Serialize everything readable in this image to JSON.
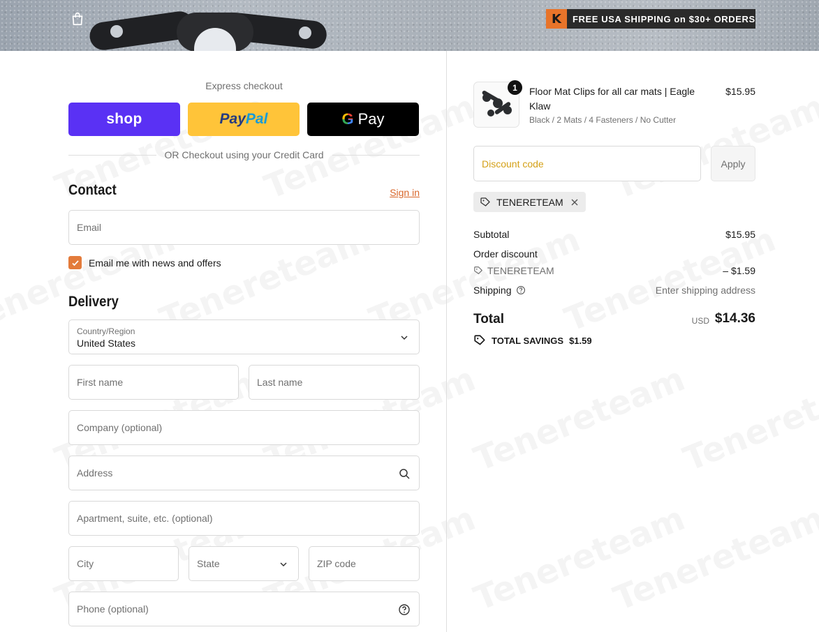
{
  "header": {
    "promo_text": "FREE USA SHIPPING on $30+ ORDERS",
    "logo_letter": "K",
    "bag_icon": "shopping-bag-icon"
  },
  "express": {
    "label": "Express checkout",
    "shop_label": "shop",
    "paypal_label_1": "Pay",
    "paypal_label_2": "Pal",
    "gpay_g": "G",
    "gpay_label": "Pay",
    "or_text": "OR Checkout using your Credit Card"
  },
  "contact": {
    "title": "Contact",
    "sign_in": "Sign in",
    "email_placeholder": "Email",
    "newsletter_label": "Email me with news and offers",
    "newsletter_checked": true
  },
  "delivery": {
    "title": "Delivery",
    "country_label": "Country/Region",
    "country_value": "United States",
    "first_name": "First name",
    "last_name": "Last name",
    "company": "Company (optional)",
    "address": "Address",
    "apartment": "Apartment, suite, etc. (optional)",
    "city": "City",
    "state": "State",
    "zip": "ZIP code",
    "phone": "Phone (optional)"
  },
  "order": {
    "quantity": "1",
    "product_title": "Floor Mat Clips for all car mats | Eagle Klaw",
    "variant": "Black / 2 Mats / 4 Fasteners / No Cutter",
    "price": "$15.95",
    "discount_placeholder": "Discount code",
    "apply_label": "Apply",
    "applied_code": "TENERETEAM",
    "subtotal_label": "Subtotal",
    "subtotal_value": "$15.95",
    "order_discount_label": "Order discount",
    "discount_code": "TENERETEAM",
    "discount_value": "– $1.59",
    "shipping_label": "Shipping",
    "shipping_value": "Enter shipping address",
    "total_label": "Total",
    "currency": "USD",
    "total_value": "$14.36",
    "savings_label": "TOTAL SAVINGS",
    "savings_value": "$1.59"
  },
  "colors": {
    "accent": "#d8662a",
    "shop": "#5a31f4",
    "paypal": "#ffc439",
    "checkbox": "#e37b3b"
  }
}
